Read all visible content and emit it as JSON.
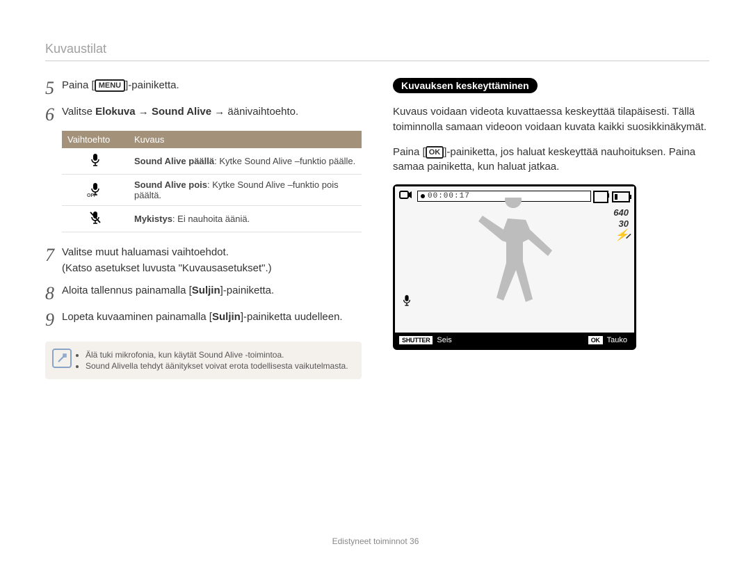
{
  "section_header": "Kuvaustilat",
  "left": {
    "step5": {
      "num": "5",
      "pre": "Paina [",
      "chip": "MENU",
      "post": "]-painiketta."
    },
    "step6": {
      "num": "6",
      "pre": "Valitse ",
      "bold1": "Elokuva",
      "arrow1": " → ",
      "bold2": "Sound Alive",
      "arrow2": " → äänivaihtoehto."
    },
    "table": {
      "h1": "Vaihtoehto",
      "h2": "Kuvaus",
      "r1_bold": "Sound Alive päällä",
      "r1_rest": ": Kytke Sound Alive –funktio päälle.",
      "r2_bold": "Sound Alive pois",
      "r2_rest": ": Kytke Sound Alive –funktio pois päältä.",
      "r3_bold": "Mykistys",
      "r3_rest": ": Ei nauhoita ääniä."
    },
    "step7": {
      "num": "7",
      "line1": "Valitse muut haluamasi vaihtoehdot.",
      "line2": "(Katso asetukset luvusta \"Kuvausasetukset\".)"
    },
    "step8": {
      "num": "8",
      "pre": "Aloita tallennus painamalla [",
      "bold": "Suljin",
      "post": "]-painiketta."
    },
    "step9": {
      "num": "9",
      "pre": "Lopeta kuvaaminen painamalla [",
      "bold": "Suljin",
      "post": "]-painiketta uudelleen."
    },
    "notes": {
      "n1": "Älä tuki mikrofonia, kun käytät Sound Alive -toimintoa.",
      "n2": "Sound Alivella tehdyt äänitykset voivat erota todellisesta vaikutelmasta."
    }
  },
  "right": {
    "pill": "Kuvauksen keskeyttäminen",
    "para1": "Kuvaus voidaan videota kuvattaessa keskeyttää tilapäisesti. Tällä toiminnolla samaan videoon voidaan kuvata kaikki suosikkinäkymät.",
    "para2_pre": "Paina [",
    "para2_chip": "OK",
    "para2_post": "]-painiketta, jos haluat keskeyttää nauhoituksen. Paina samaa painiketta, kun haluat jatkaa.",
    "hud": {
      "timer": "00:00:17",
      "res": "640",
      "fps": "30"
    },
    "footer": {
      "shutter_chip": "SHUTTER",
      "shutter_label": "Seis",
      "ok_chip": "OK",
      "ok_label": "Tauko"
    }
  },
  "footer": {
    "text": "Edistyneet toiminnot",
    "page": "36"
  }
}
